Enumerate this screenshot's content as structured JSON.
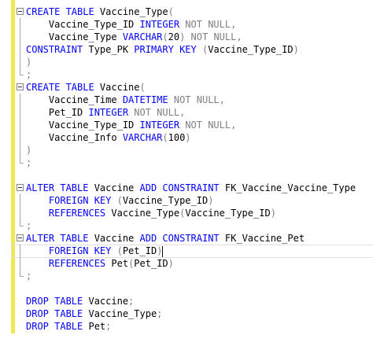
{
  "editor": {
    "lines": [
      {
        "fold": "start",
        "tokens": [
          {
            "t": "CREATE TABLE",
            "c": "kw"
          },
          {
            "t": " Vaccine_Type",
            "c": "tx"
          },
          {
            "t": "(",
            "c": "gr"
          }
        ]
      },
      {
        "fold": "mid",
        "tokens": [
          {
            "t": "    Vaccine_Type_ID ",
            "c": "tx"
          },
          {
            "t": "INTEGER",
            "c": "kw"
          },
          {
            "t": " NOT NULL,",
            "c": "gr"
          }
        ]
      },
      {
        "fold": "mid",
        "tokens": [
          {
            "t": "    Vaccine_Type ",
            "c": "tx"
          },
          {
            "t": "VARCHAR",
            "c": "kw"
          },
          {
            "t": "(",
            "c": "gr"
          },
          {
            "t": "20",
            "c": "tx"
          },
          {
            "t": ") NOT NULL,",
            "c": "gr"
          }
        ]
      },
      {
        "fold": "mid",
        "tokens": [
          {
            "t": "CONSTRAINT",
            "c": "kw"
          },
          {
            "t": " Type_PK ",
            "c": "tx"
          },
          {
            "t": "PRIMARY KEY",
            "c": "kw"
          },
          {
            "t": " (",
            "c": "gr"
          },
          {
            "t": "Vaccine_Type_ID",
            "c": "tx"
          },
          {
            "t": ")",
            "c": "gr"
          }
        ]
      },
      {
        "fold": "mid",
        "tokens": [
          {
            "t": ")",
            "c": "gr"
          }
        ]
      },
      {
        "fold": "end",
        "tokens": [
          {
            "t": ";",
            "c": "gr"
          }
        ]
      },
      {
        "fold": "start",
        "tokens": [
          {
            "t": "CREATE TABLE",
            "c": "kw"
          },
          {
            "t": " Vaccine",
            "c": "tx"
          },
          {
            "t": "(",
            "c": "gr"
          }
        ]
      },
      {
        "fold": "mid",
        "tokens": [
          {
            "t": "    Vaccine_Time ",
            "c": "tx"
          },
          {
            "t": "DATETIME",
            "c": "kw"
          },
          {
            "t": " NOT NULL,",
            "c": "gr"
          }
        ]
      },
      {
        "fold": "mid",
        "tokens": [
          {
            "t": "    Pet_ID ",
            "c": "tx"
          },
          {
            "t": "INTEGER",
            "c": "kw"
          },
          {
            "t": " NOT NULL,",
            "c": "gr"
          }
        ]
      },
      {
        "fold": "mid",
        "tokens": [
          {
            "t": "    Vaccine_Type_ID ",
            "c": "tx"
          },
          {
            "t": "INTEGER",
            "c": "kw"
          },
          {
            "t": " NOT NULL,",
            "c": "gr"
          }
        ]
      },
      {
        "fold": "mid",
        "tokens": [
          {
            "t": "    Vaccine_Info ",
            "c": "tx"
          },
          {
            "t": "VARCHAR",
            "c": "kw"
          },
          {
            "t": "(",
            "c": "gr"
          },
          {
            "t": "100",
            "c": "tx"
          },
          {
            "t": ")",
            "c": "gr"
          }
        ]
      },
      {
        "fold": "mid",
        "tokens": [
          {
            "t": ")",
            "c": "gr"
          }
        ]
      },
      {
        "fold": "end",
        "tokens": [
          {
            "t": ";",
            "c": "gr"
          }
        ]
      },
      {
        "fold": "none",
        "tokens": []
      },
      {
        "fold": "start",
        "tokens": [
          {
            "t": "ALTER TABLE",
            "c": "kw"
          },
          {
            "t": " Vaccine ",
            "c": "tx"
          },
          {
            "t": "ADD CONSTRAINT",
            "c": "kw"
          },
          {
            "t": " FK_Vaccine_Vaccine_Type",
            "c": "tx"
          }
        ]
      },
      {
        "fold": "mid",
        "tokens": [
          {
            "t": "    FOREIGN KEY",
            "c": "kw"
          },
          {
            "t": " (",
            "c": "gr"
          },
          {
            "t": "Vaccine_Type_ID",
            "c": "tx"
          },
          {
            "t": ")",
            "c": "gr"
          }
        ]
      },
      {
        "fold": "mid",
        "tokens": [
          {
            "t": "    REFERENCES",
            "c": "kw"
          },
          {
            "t": " Vaccine_Type",
            "c": "tx"
          },
          {
            "t": "(",
            "c": "gr"
          },
          {
            "t": "Vaccine_Type_ID",
            "c": "tx"
          },
          {
            "t": ")",
            "c": "gr"
          }
        ]
      },
      {
        "fold": "end",
        "tokens": [
          {
            "t": ";",
            "c": "gr"
          }
        ]
      },
      {
        "fold": "start",
        "tokens": [
          {
            "t": "ALTER TABLE",
            "c": "kw"
          },
          {
            "t": " Vaccine ",
            "c": "tx"
          },
          {
            "t": "ADD CONSTRAINT",
            "c": "kw"
          },
          {
            "t": " FK_Vaccine_Pet",
            "c": "tx"
          }
        ]
      },
      {
        "fold": "mid",
        "current": true,
        "caretAfter": true,
        "tokens": [
          {
            "t": "    FOREIGN KEY",
            "c": "kw"
          },
          {
            "t": " (",
            "c": "gr"
          },
          {
            "t": "Pet_ID",
            "c": "tx"
          },
          {
            "t": ")",
            "c": "gr"
          }
        ]
      },
      {
        "fold": "mid",
        "tokens": [
          {
            "t": "    REFERENCES",
            "c": "kw"
          },
          {
            "t": " Pet",
            "c": "tx"
          },
          {
            "t": "(",
            "c": "gr"
          },
          {
            "t": "Pet_ID",
            "c": "tx"
          },
          {
            "t": ")",
            "c": "gr"
          }
        ]
      },
      {
        "fold": "end",
        "tokens": [
          {
            "t": ";",
            "c": "gr"
          }
        ]
      },
      {
        "fold": "none",
        "tokens": []
      },
      {
        "fold": "none",
        "tokens": [
          {
            "t": "DROP TABLE",
            "c": "kw"
          },
          {
            "t": " Vaccine",
            "c": "tx"
          },
          {
            "t": ";",
            "c": "gr"
          }
        ]
      },
      {
        "fold": "none",
        "tokens": [
          {
            "t": "DROP TABLE",
            "c": "kw"
          },
          {
            "t": " Vaccine_Type",
            "c": "tx"
          },
          {
            "t": ";",
            "c": "gr"
          }
        ]
      },
      {
        "fold": "none",
        "tokens": [
          {
            "t": "DROP TABLE",
            "c": "kw"
          },
          {
            "t": " Pet",
            "c": "tx"
          },
          {
            "t": ";",
            "c": "gr"
          }
        ]
      }
    ]
  },
  "colors": {
    "keyword": "#0000ff",
    "operator": "#808080",
    "text": "#000000",
    "change_bar": "#f2e94e"
  }
}
